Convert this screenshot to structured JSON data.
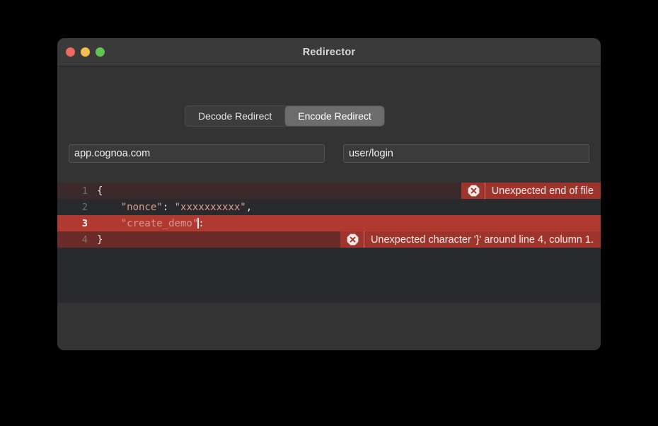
{
  "window": {
    "title": "Redirector",
    "traffic_lights": [
      {
        "name": "close",
        "color": "#ec6a5e"
      },
      {
        "name": "minimize",
        "color": "#f4bd4f"
      },
      {
        "name": "zoom",
        "color": "#61c554"
      }
    ]
  },
  "segmented_control": {
    "options": [
      {
        "label": "Decode Redirect",
        "selected": false
      },
      {
        "label": "Encode Redirect",
        "selected": true
      }
    ]
  },
  "inputs": {
    "host": {
      "value": "app.cognoa.com",
      "placeholder": "app.cognoa.com"
    },
    "path": {
      "value": "user/login",
      "placeholder": "user/login"
    }
  },
  "editor": {
    "language": "json",
    "lines": [
      {
        "number": "1",
        "state": "error-soft",
        "text": "{",
        "segments": [
          {
            "kind": "punct",
            "text": "{"
          }
        ]
      },
      {
        "number": "2",
        "state": "plain",
        "text": "    \"nonce\": \"xxxxxxxxxx\",",
        "segments": [
          {
            "kind": "plain",
            "text": "    "
          },
          {
            "kind": "string",
            "text": "\"nonce\""
          },
          {
            "kind": "punct",
            "text": ": "
          },
          {
            "kind": "string",
            "text": "\"xxxxxxxxxx\""
          },
          {
            "kind": "punct",
            "text": ","
          }
        ]
      },
      {
        "number": "3",
        "state": "current",
        "text": "    \"create_demo\":",
        "segments": [
          {
            "kind": "plain",
            "text": "    "
          },
          {
            "kind": "key",
            "text": "\"create_demo\""
          },
          {
            "kind": "caret",
            "text": ""
          },
          {
            "kind": "punct",
            "text": ":"
          }
        ]
      },
      {
        "number": "4",
        "state": "error-deep",
        "text": "}",
        "segments": [
          {
            "kind": "punct",
            "text": "}"
          }
        ]
      }
    ],
    "errors": [
      {
        "line": "1",
        "icon": "error-octagon-icon",
        "message": "Unexpected end of file"
      },
      {
        "line": "4",
        "icon": "error-octagon-icon",
        "message": "Unexpected character '}' around line 4, column 1."
      }
    ]
  },
  "colors": {
    "desktop_background": "#000000",
    "window_background": "#333333",
    "titlebar": "#3a3a3a",
    "editor_background": "#282a2e",
    "error_line_current": "#b03a30",
    "error_line_soft": "#3c2a2a",
    "error_line_deep": "#6b2b28",
    "error_banner": "#9e342c",
    "string_token": "#e09a8c",
    "segment_selected": "#6c6c6c"
  }
}
